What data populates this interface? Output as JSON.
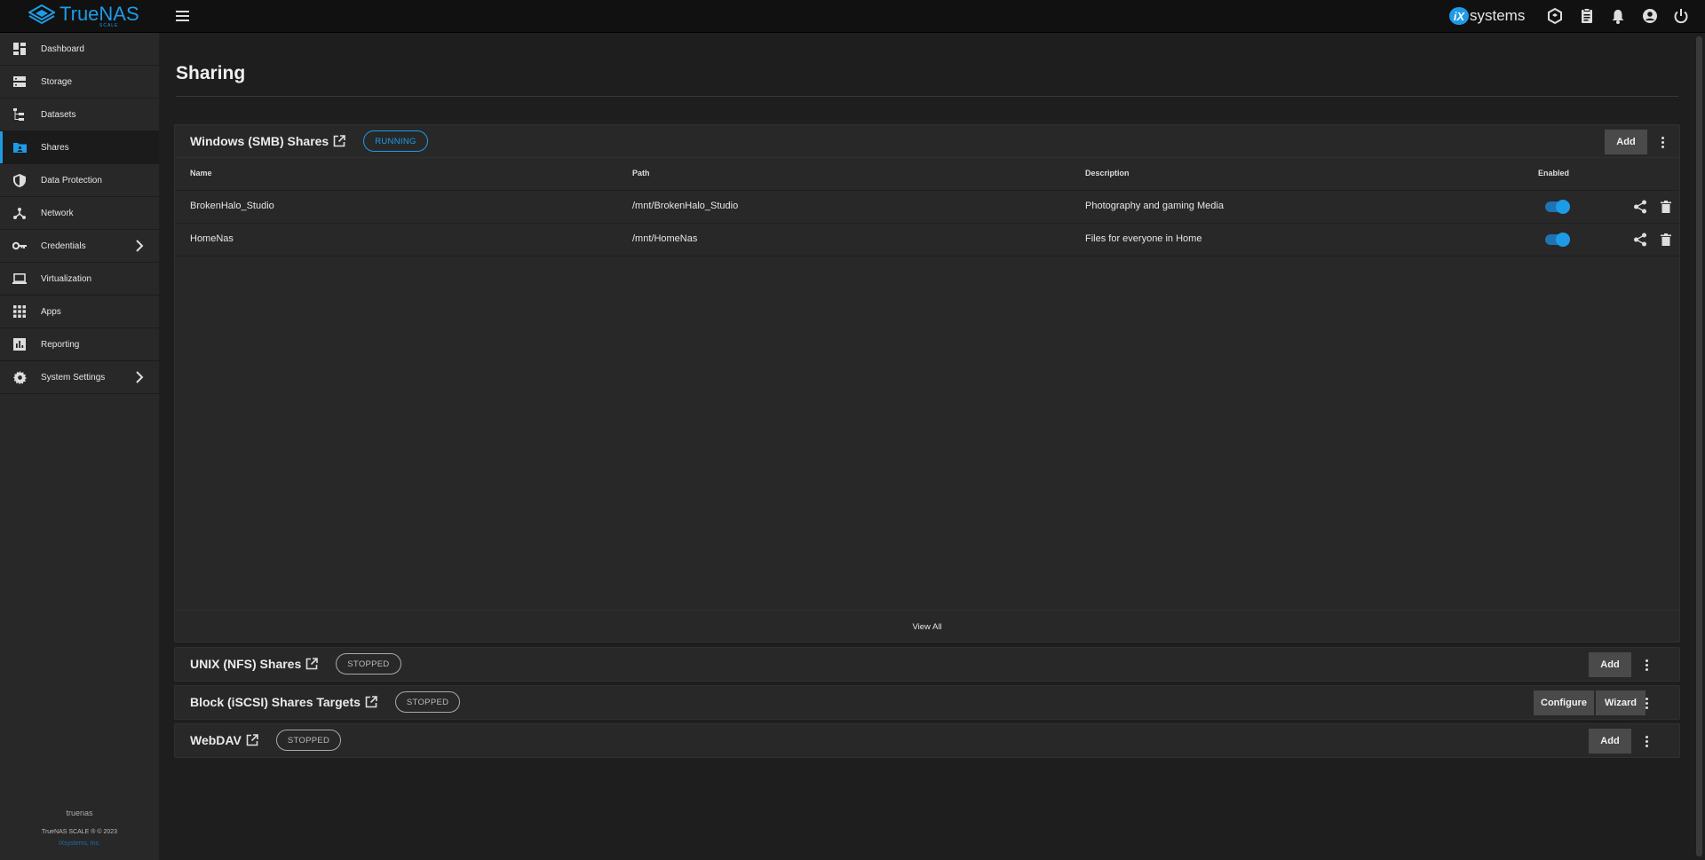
{
  "app": {
    "logo_text": "TrueNAS",
    "logo_sub": "SCALE",
    "vendor": "systems",
    "vendor_mark": "iX"
  },
  "sidebar": {
    "items": [
      {
        "label": "Dashboard"
      },
      {
        "label": "Storage"
      },
      {
        "label": "Datasets"
      },
      {
        "label": "Shares"
      },
      {
        "label": "Data Protection"
      },
      {
        "label": "Network"
      },
      {
        "label": "Credentials"
      },
      {
        "label": "Virtualization"
      },
      {
        "label": "Apps"
      },
      {
        "label": "Reporting"
      },
      {
        "label": "System Settings"
      }
    ],
    "hostname": "truenas",
    "copyright": "TrueNAS SCALE ® © 2023",
    "company_link": "iXsystems, Inc."
  },
  "page": {
    "title": "Sharing"
  },
  "smb": {
    "title": "Windows (SMB) Shares",
    "status": "RUNNING",
    "add_label": "Add",
    "columns": {
      "name": "Name",
      "path": "Path",
      "description": "Description",
      "enabled": "Enabled"
    },
    "rows": [
      {
        "name": "BrokenHalo_Studio",
        "path": "/mnt/BrokenHalo_Studio",
        "description": "Photography and gaming Media"
      },
      {
        "name": "HomeNas",
        "path": "/mnt/HomeNas",
        "description": "Files for everyone in Home"
      }
    ],
    "view_all": "View All"
  },
  "nfs": {
    "title": "UNIX (NFS) Shares",
    "status": "STOPPED",
    "add_label": "Add"
  },
  "iscsi": {
    "title": "Block (iSCSI) Shares Targets",
    "status": "STOPPED",
    "configure_label": "Configure",
    "wizard_label": "Wizard"
  },
  "webdav": {
    "title": "WebDAV",
    "status": "STOPPED",
    "add_label": "Add"
  },
  "colors": {
    "accent": "#1e9be6",
    "background": "#1e1e1e",
    "card": "#282828",
    "topbar": "#111111"
  }
}
